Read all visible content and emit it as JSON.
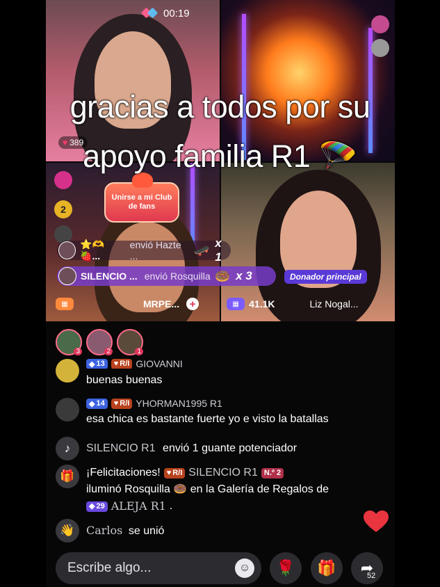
{
  "status": {
    "timer": "00:19"
  },
  "caption": {
    "line1": "gracias a todos por su",
    "line2": "apoyo familia R1 🪂"
  },
  "stream": {
    "like_count": "389",
    "fan_club": {
      "line1": "Unirse a mi Club",
      "line2": "de fans"
    },
    "side_badge": "2"
  },
  "gifts": [
    {
      "name": "⭐🫶🍓...",
      "action": "envió Hazte ...",
      "gift_icon": "🛹",
      "qty": "x 1"
    },
    {
      "name": "SILENCIO ...",
      "action": "envió Rosquilla",
      "gift_icon": "🍩",
      "qty": "x 3"
    }
  ],
  "donador_label": "Donador principal",
  "scorebar": {
    "left_name": "MRPE...",
    "score": "41.1K",
    "right_name": "Liz Nogal..."
  },
  "viewers": [
    {
      "rank": "3"
    },
    {
      "rank": "2"
    },
    {
      "rank": "1"
    }
  ],
  "chat": {
    "m1": {
      "level": "13",
      "fan": "R/I",
      "user": "GIOVANNI",
      "text": "buenas buenas"
    },
    "m2": {
      "level": "14",
      "fan": "R/I",
      "user": "YHORMAN1995 R1",
      "text": "esa chica es bastante fuerte yo e visto la batallas"
    },
    "m3": {
      "user": "SILENCIO  R1",
      "text": "envió 1 guante potenciador"
    },
    "m4": {
      "prefix": "¡Felicitaciones!",
      "fan": "R/I",
      "user": "SILENCIO  R1",
      "rank": "N.º 2",
      "line2a": "iluminó Rosquilla",
      "line2b": "en la Galería de Regalos de",
      "level": "29",
      "target": "ALEJA R1",
      "end": "."
    },
    "m5": {
      "user": "Carlos",
      "text": "se unió"
    }
  },
  "bottom": {
    "placeholder": "Escribe algo...",
    "share_count": "52"
  },
  "icons": {
    "tiktok": "tiktok-icon",
    "gift": "gift-icon",
    "wave": "wave-hand-icon",
    "heart": "heart-icon",
    "rose": "rose-icon",
    "share": "share-icon",
    "emoji": "emoji-icon"
  },
  "colors": {
    "accent": "#e0345b",
    "purple_bar": "#7c5cff",
    "like_heart": "#e8353f"
  }
}
